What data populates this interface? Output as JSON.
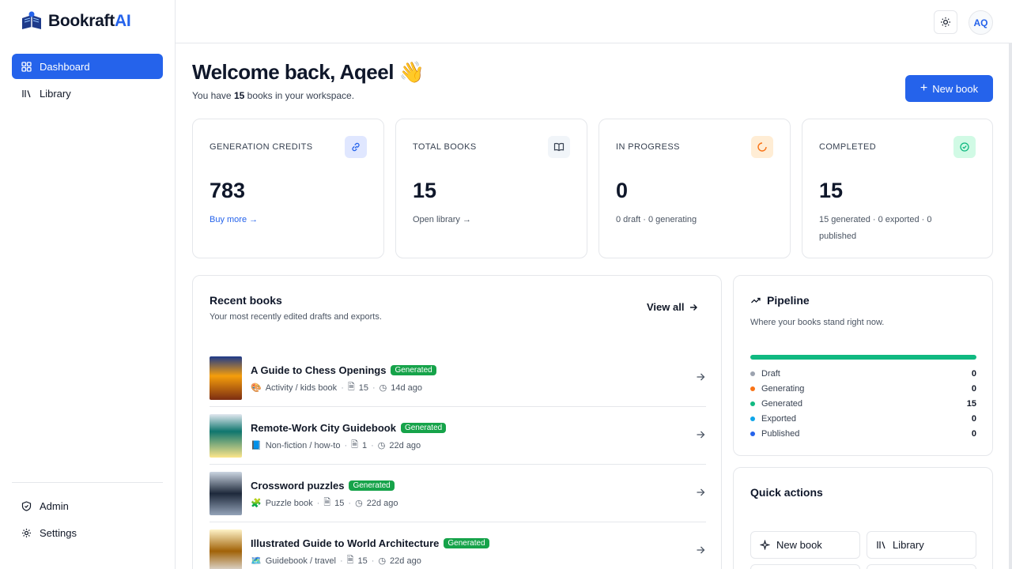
{
  "brand": {
    "name_main": "Bookraft",
    "name_accent": "AI"
  },
  "sidebar": {
    "items": [
      {
        "label": "Dashboard",
        "icon": "dashboard-icon"
      },
      {
        "label": "Library",
        "icon": "library-icon"
      }
    ],
    "bottom_items": [
      {
        "label": "Admin",
        "icon": "shield-icon"
      },
      {
        "label": "Settings",
        "icon": "gear-icon"
      }
    ]
  },
  "topbar": {
    "theme_icon": "sun-icon",
    "avatar_initials": "AQ"
  },
  "header": {
    "welcome": "Welcome back, Aqeel 👋",
    "subtitle_prefix": "You have ",
    "subtitle_count": "15",
    "subtitle_suffix": " books in your workspace.",
    "new_book_label": "New book"
  },
  "stats": [
    {
      "label": "GENERATION CREDITS",
      "value": "783",
      "footer": "Buy more →",
      "icon": "link-icon",
      "color": "#2563eb"
    },
    {
      "label": "TOTAL BOOKS",
      "value": "15",
      "footer": "Open library →",
      "icon": "book-open-icon",
      "color": "#374151"
    },
    {
      "label": "IN PROGRESS",
      "value": "0",
      "footer": "0 draft · 0 generating",
      "icon": "loader-icon",
      "color": "#f97316"
    },
    {
      "label": "COMPLETED",
      "value": "15",
      "footer": "15 generated · 0 exported · 0 published",
      "icon": "check-circle-icon",
      "color": "#10b981"
    }
  ],
  "recent": {
    "title": "Recent books",
    "subtitle": "Your most recently edited drafts and exports.",
    "view_all": "View all",
    "books": [
      {
        "title": "A Guide to Chess Openings",
        "status": "Generated",
        "category_icon": "🎨",
        "category": "Activity / kids book",
        "pages": "15",
        "age": "14d ago"
      },
      {
        "title": "Remote-Work City Guidebook",
        "status": "Generated",
        "category_icon": "📘",
        "category": "Non-fiction / how-to",
        "pages": "1",
        "age": "22d ago"
      },
      {
        "title": "Crossword puzzles",
        "status": "Generated",
        "category_icon": "🧩",
        "category": "Puzzle book",
        "pages": "15",
        "age": "22d ago"
      },
      {
        "title": "Illustrated Guide to World Architecture",
        "status": "Generated",
        "category_icon": "🗺️",
        "category": "Guidebook / travel",
        "pages": "15",
        "age": "22d ago"
      }
    ]
  },
  "pipeline": {
    "title": "Pipeline",
    "subtitle": "Where your books stand right now.",
    "progress_fraction": 1.0,
    "rows": [
      {
        "label": "Draft",
        "value": "0",
        "color": "#9ca3af"
      },
      {
        "label": "Generating",
        "value": "0",
        "color": "#f97316"
      },
      {
        "label": "Generated",
        "value": "15",
        "color": "#10b981"
      },
      {
        "label": "Exported",
        "value": "0",
        "color": "#0ea5e9"
      },
      {
        "label": "Published",
        "value": "0",
        "color": "#2563eb"
      }
    ]
  },
  "quick_actions": {
    "title": "Quick actions",
    "buttons": [
      {
        "label": "New book",
        "icon": "sparkles-icon"
      },
      {
        "label": "Library",
        "icon": "library-icon"
      }
    ]
  }
}
